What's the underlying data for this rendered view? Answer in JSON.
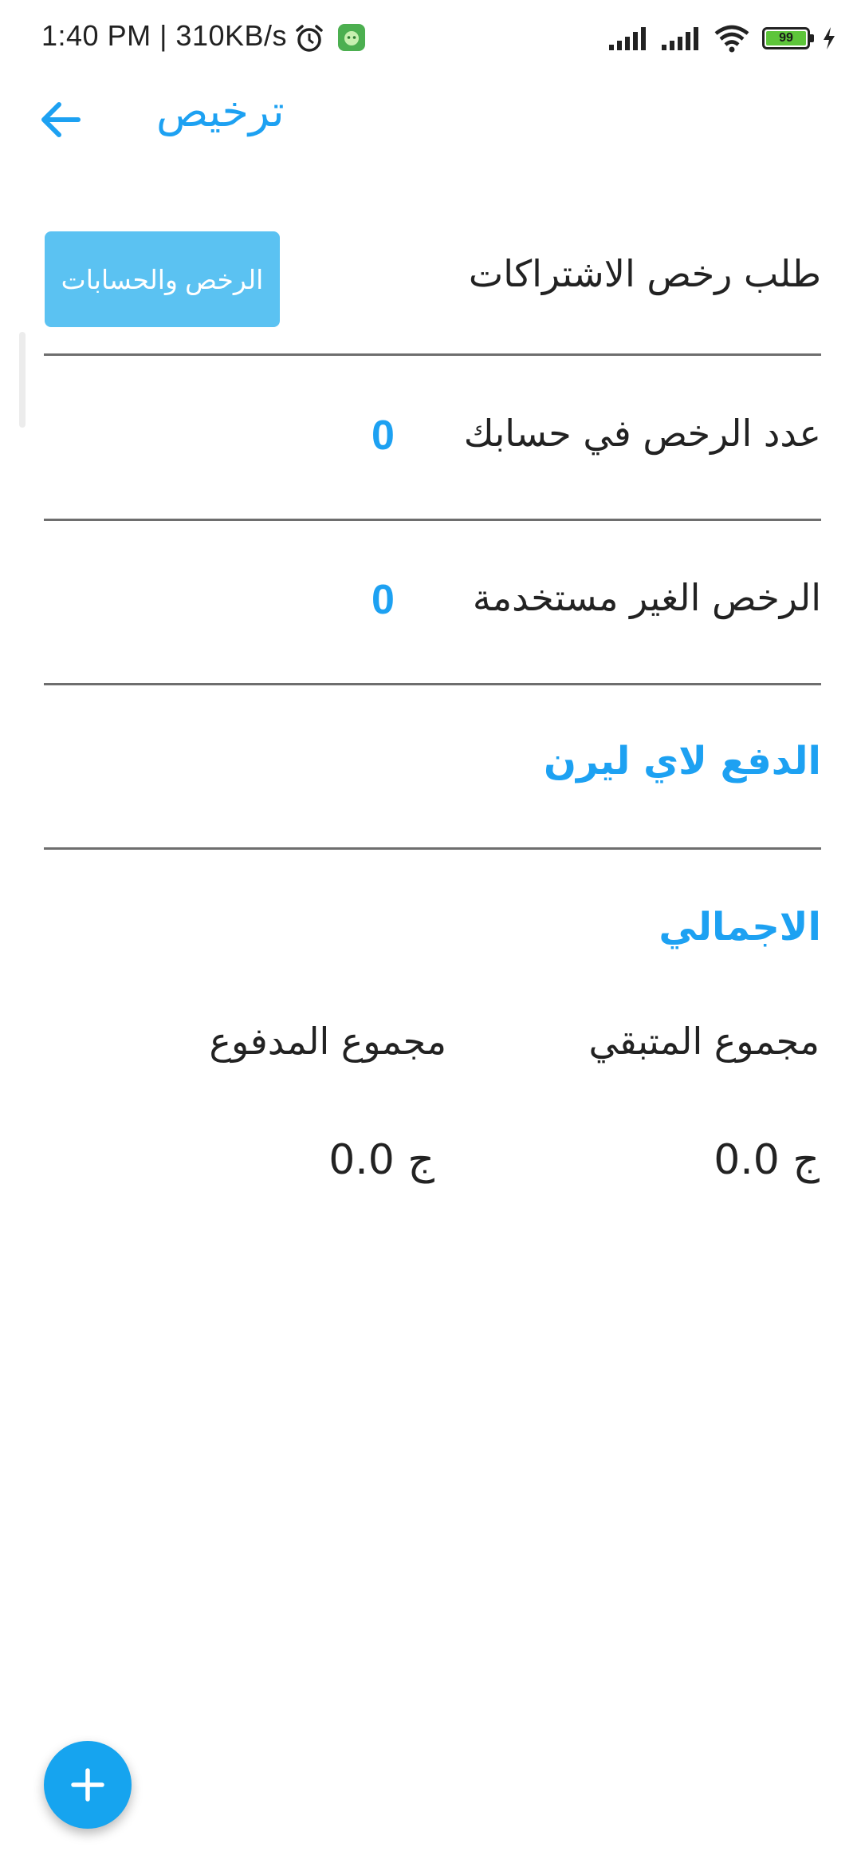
{
  "status_bar": {
    "time_speed": "1:40 PM | 310KB/s",
    "battery_level": "99",
    "icons": [
      "alarm-icon",
      "app-notification-icon",
      "signal-icon",
      "signal-icon",
      "wifi-icon",
      "battery-icon",
      "charging-icon"
    ]
  },
  "toolbar": {
    "title": "ترخيص",
    "back_icon": "arrow-left-icon"
  },
  "license_request": {
    "label": "طلب رخص الاشتراكات",
    "button_label": "الرخص والحسابات"
  },
  "license_count": {
    "label": "عدد الرخص في حسابك",
    "value": "0"
  },
  "unused_licenses": {
    "label": "الرخص الغير مستخدمة",
    "value": "0"
  },
  "payment_link": {
    "label": "الدفع لاي ليرن"
  },
  "totals": {
    "heading": "الاجمالي",
    "remaining_label": "مجموع المتبقي",
    "paid_label": "مجموع المدفوع",
    "remaining_value": "ج 0.0",
    "paid_value": "ج 0.0"
  },
  "fab": {
    "icon": "plus-icon"
  },
  "colors": {
    "accent": "#1da1f2",
    "button": "#5bc2f2",
    "fab": "#16a4ef",
    "divider": "#6e6e6e",
    "text": "#222222"
  }
}
